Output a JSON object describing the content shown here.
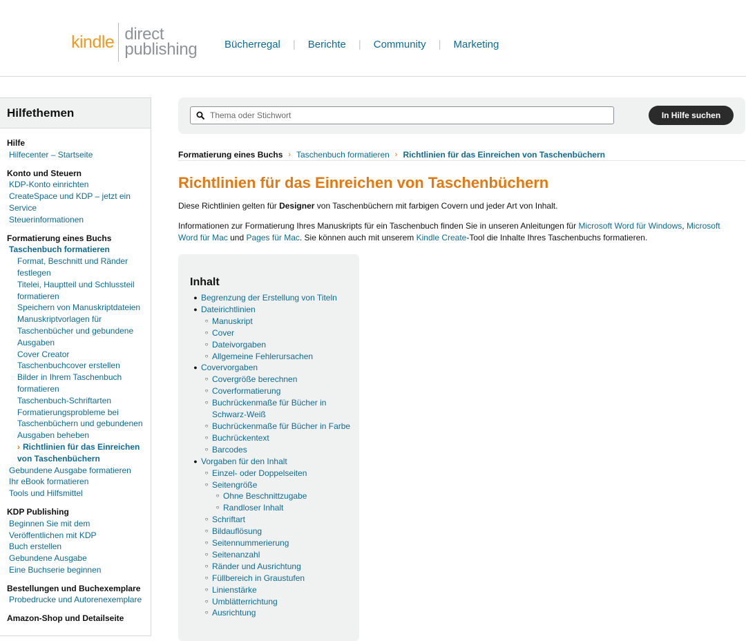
{
  "header": {
    "logo_kindle": "kindle",
    "logo_direct": "direct",
    "logo_publishing": "publishing",
    "nav": [
      "Bücherregal",
      "Berichte",
      "Community",
      "Marketing"
    ],
    "nav_separator": "|"
  },
  "sidebar": {
    "title": "Hilfethemen",
    "sections": [
      {
        "title": "Hilfe",
        "links": [
          "Hilfecenter – Startseite"
        ]
      },
      {
        "title": "Konto und Steuern",
        "links": [
          "KDP-Konto einrichten",
          "CreateSpace und KDP – jetzt ein Service",
          "Steuerinformationen"
        ]
      },
      {
        "title": "Formatierung eines Buchs",
        "current_parent": "Taschenbuch formatieren",
        "sublinks": [
          "Format, Beschnitt und Ränder festlegen",
          "Titelei, Hauptteil und Schlussteil formatieren",
          "Speichern von Manuskriptdateien",
          "Manuskriptvorlagen für Taschenbücher und gebundene Ausgaben",
          "Cover Creator",
          "Taschenbuchcover erstellen",
          "Bilder in Ihrem Taschenbuch formatieren",
          "Taschenbuch-Schriftarten",
          "Formatierungsprobleme bei Taschenbüchern und gebundenen Ausgaben beheben"
        ],
        "active": "Richtlinien für das Einreichen von Taschenbüchern",
        "active_marker": "›",
        "after": [
          "Gebundene Ausgabe formatieren",
          "Ihr eBook formatieren",
          "Tools und Hilfsmittel"
        ]
      },
      {
        "title": "KDP Publishing",
        "links": [
          "Beginnen Sie mit dem",
          "Veröffentlichen mit KDP",
          "Buch erstellen",
          "Gebundene Ausgabe",
          "Eine Buchserie beginnen"
        ]
      },
      {
        "title": "Bestellungen und Buchexemplare",
        "links": [
          "Probedrucke und Autorenexemplare"
        ]
      },
      {
        "title": "Amazon-Shop und Detailseite",
        "links": []
      }
    ]
  },
  "search": {
    "placeholder": "Thema oder Stichwort",
    "value": "",
    "button": "In Hilfe suchen",
    "icon": "search-icon"
  },
  "breadcrumb": {
    "root": "Formatierung eines Buchs",
    "middle": "Taschenbuch formatieren",
    "current": "Richtlinien für das Einreichen von Taschenbüchern",
    "separator": "›"
  },
  "article": {
    "title": "Richtlinien für das Einreichen von Taschenbüchern",
    "intro_before": "Diese Richtlinien gelten für ",
    "intro_bold": "Designer",
    "intro_after": " von Taschenbüchern mit farbigen Covern und jeder Art von Inhalt.",
    "p2_a": "Informationen zur Formatierung Ihres Manuskripts für ein Taschenbuch finden Sie in unseren Anleitungen für ",
    "p2_link1": "Microsoft Word für Windows",
    "p2_b": ", ",
    "p2_link2": "Microsoft Word für Mac",
    "p2_c": " und ",
    "p2_link3": "Pages für Mac",
    "p2_d": ". Sie können auch mit unserem ",
    "p2_link4": "Kindle Create",
    "p2_e": "-Tool die Inhalte Ihres Taschenbuchs formatieren."
  },
  "toc": {
    "title": "Inhalt",
    "items": [
      {
        "level": 1,
        "text": "Begrenzung der Erstellung von Titeln"
      },
      {
        "level": 1,
        "text": "Dateirichtlinien"
      },
      {
        "level": 2,
        "text": "Manuskript"
      },
      {
        "level": 2,
        "text": "Cover"
      },
      {
        "level": 2,
        "text": "Dateivorgaben"
      },
      {
        "level": 2,
        "text": "Allgemeine Fehlerursachen"
      },
      {
        "level": 1,
        "text": "Covervorgaben"
      },
      {
        "level": 2,
        "text": "Covergröße berechnen"
      },
      {
        "level": 2,
        "text": "Coverformatierung"
      },
      {
        "level": 2,
        "text": "Buchrückenmaße für Bücher in Schwarz-Weiß"
      },
      {
        "level": 2,
        "text": "Buchrückenmaße für Bücher in Farbe"
      },
      {
        "level": 2,
        "text": "Buchrückentext"
      },
      {
        "level": 2,
        "text": "Barcodes"
      },
      {
        "level": 1,
        "text": "Vorgaben für den Inhalt"
      },
      {
        "level": 2,
        "text": "Einzel- oder Doppelseiten"
      },
      {
        "level": 2,
        "text": "Seitengröße"
      },
      {
        "level": 3,
        "text": "Ohne Beschnittzugabe"
      },
      {
        "level": 3,
        "text": "Randloser Inhalt"
      },
      {
        "level": 2,
        "text": "Schriftart"
      },
      {
        "level": 2,
        "text": "Bildauflösung"
      },
      {
        "level": 2,
        "text": "Seitennummerierung"
      },
      {
        "level": 2,
        "text": "Seitenanzahl"
      },
      {
        "level": 2,
        "text": "Ränder und Ausrichtung"
      },
      {
        "level": 2,
        "text": "Füllbereich in Graustufen"
      },
      {
        "level": 2,
        "text": "Linienstärke"
      },
      {
        "level": 2,
        "text": "Umblätterrichtung"
      },
      {
        "level": 2,
        "text": "Ausrichtung"
      }
    ]
  },
  "colors": {
    "link": "#0f6a95",
    "accent_orange": "#e47911",
    "logo_orange": "#ee9a22",
    "panel_gray": "#f0f2f2",
    "button_dark": "#2b2b2b"
  }
}
